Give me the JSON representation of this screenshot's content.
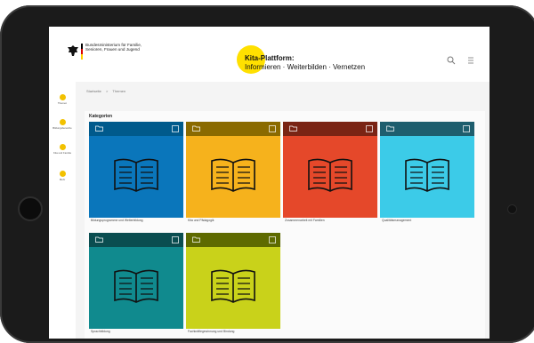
{
  "header": {
    "ministry_text": "Bundesministerium für Familie, Senioren, Frauen und Jugend",
    "title_main": "Kita-Plattform:",
    "title_sub": "Informieren · Weiterbilden · Vernetzen"
  },
  "sidebar": {
    "items": [
      {
        "label": "Themen"
      },
      {
        "label": "Bildungsbereiche"
      },
      {
        "label": "Kita und Familie"
      },
      {
        "label": "Mehr"
      }
    ]
  },
  "breadcrumb": [
    "Startseite",
    ">",
    "Themen"
  ],
  "section": {
    "title": "Kategorien"
  },
  "tiles": [
    {
      "label": "Bildungsprogramme und Weiterbildung",
      "head_color": "#005a8c",
      "body_color": "#0a76bb"
    },
    {
      "label": "Kita und Pädagogik",
      "head_color": "#8a6a00",
      "body_color": "#f6b21c"
    },
    {
      "label": "Zusammenarbeit mit Familien",
      "head_color": "#7a2414",
      "body_color": "#e5482a"
    },
    {
      "label": "Qualitätsmanagement",
      "head_color": "#1e5e6e",
      "body_color": "#3ccbe8"
    },
    {
      "label": "Sprachbildung",
      "head_color": "#0a4d50",
      "body_color": "#108a8e"
    },
    {
      "label": "Fachkräftegewinnung und Bindung",
      "head_color": "#5e6a00",
      "body_color": "#c9d21a"
    }
  ]
}
